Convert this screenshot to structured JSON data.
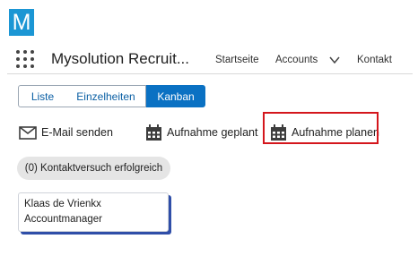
{
  "logo": {
    "letter": "M",
    "color": "#1b96d4"
  },
  "header": {
    "app_launcher_icon": "app-launcher-grid-icon",
    "app_title": "Mysolution Recruit...",
    "nav": [
      {
        "label": "Startseite"
      },
      {
        "label": "Accounts"
      },
      {
        "label": "Kontakt"
      }
    ]
  },
  "view_switch": {
    "options": [
      {
        "label": "Liste",
        "active": false
      },
      {
        "label": "Einzelheiten",
        "active": false
      },
      {
        "label": "Kanban",
        "active": true
      }
    ],
    "active_color": "#0a71c3"
  },
  "actions": [
    {
      "label": "E-Mail senden",
      "icon": "envelope-icon"
    },
    {
      "label": "Aufnahme geplant",
      "icon": "calendar-icon"
    },
    {
      "label": "Aufnahme planen",
      "icon": "calendar-icon",
      "highlighted": true
    }
  ],
  "highlight_color": "#d4161c",
  "column_header": "(0) Kontaktversuch erfolgreich",
  "card": {
    "name": "Klaas de Vrienkx",
    "role": "Accountmanager"
  }
}
